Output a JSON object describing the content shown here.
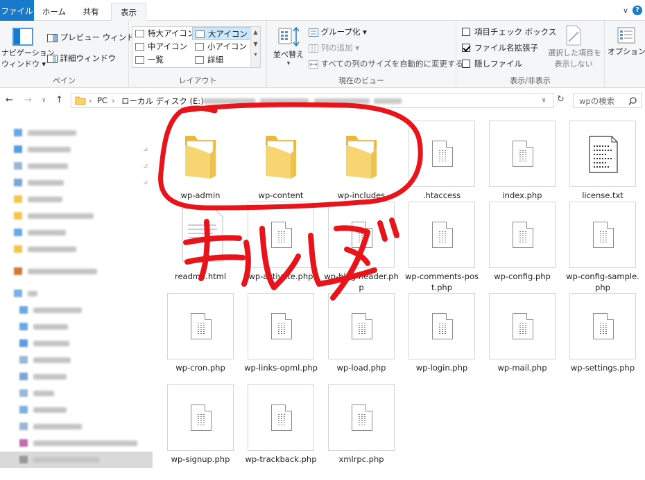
{
  "ribbon_tabs": [
    {
      "label": "ファイル"
    },
    {
      "label": "ホーム"
    },
    {
      "label": "共有"
    },
    {
      "label": "表示"
    }
  ],
  "ribbon": {
    "pane": {
      "nav_pane_line1": "ナビゲーション",
      "nav_pane_line2": "ウィンドウ",
      "preview": "プレビュー ウィンドウ",
      "details": "詳細ウィンドウ",
      "group_label": "ペイン"
    },
    "layout": {
      "items": [
        "特大アイコン",
        "大アイコン",
        "中アイコン",
        "小アイコン",
        "一覧",
        "詳細"
      ],
      "selected": "大アイコン",
      "group_label": "レイアウト"
    },
    "current_view": {
      "sort": "並べ替え",
      "group_by": "グループ化",
      "add_column": "列の追加",
      "autosize": "すべての列のサイズを自動的に変更する",
      "group_label": "現在のビュー"
    },
    "show_hide": {
      "item_checkbox": "項目チェック ボックス",
      "item_checkbox_checked": false,
      "extensions": "ファイル名拡張子",
      "extensions_checked": true,
      "hidden": "隠しファイル",
      "hidden_checked": false,
      "hide_selected_line1": "選択した項目を",
      "hide_selected_line2": "表示しない",
      "group_label": "表示/非表示"
    },
    "options": "オプション"
  },
  "address": {
    "crumbs": [
      "PC",
      "ローカル ディスク (E:)"
    ],
    "search_placeholder": "wpの検索"
  },
  "files": [
    {
      "name": "wp-admin",
      "type": "folder"
    },
    {
      "name": "wp-content",
      "type": "folder"
    },
    {
      "name": "wp-includes",
      "type": "folder"
    },
    {
      "name": ".htaccess",
      "type": "file"
    },
    {
      "name": "index.php",
      "type": "file"
    },
    {
      "name": "license.txt",
      "type": "text"
    },
    {
      "name": "readme.html",
      "type": "html"
    },
    {
      "name": "wp-activate.php",
      "type": "file"
    },
    {
      "name": "wp-blog-header.php",
      "type": "file"
    },
    {
      "name": "wp-comments-post.php",
      "type": "file"
    },
    {
      "name": "wp-config.php",
      "type": "file"
    },
    {
      "name": "wp-config-sample.php",
      "type": "file"
    },
    {
      "name": "wp-cron.php",
      "type": "file"
    },
    {
      "name": "wp-links-opml.php",
      "type": "file"
    },
    {
      "name": "wp-load.php",
      "type": "file"
    },
    {
      "name": "wp-login.php",
      "type": "file"
    },
    {
      "name": "wp-mail.php",
      "type": "file"
    },
    {
      "name": "wp-settings.php",
      "type": "file"
    },
    {
      "name": "wp-signup.php",
      "type": "file"
    },
    {
      "name": "wp-trackback.php",
      "type": "file"
    },
    {
      "name": "xmlrpc.php",
      "type": "file"
    }
  ],
  "annotation": {
    "text": "フォルダ",
    "color": "#e8141c"
  },
  "colors": {
    "file_tab": "#1979ca",
    "selection": "#cce8ff",
    "folder": "#f6d26b"
  }
}
